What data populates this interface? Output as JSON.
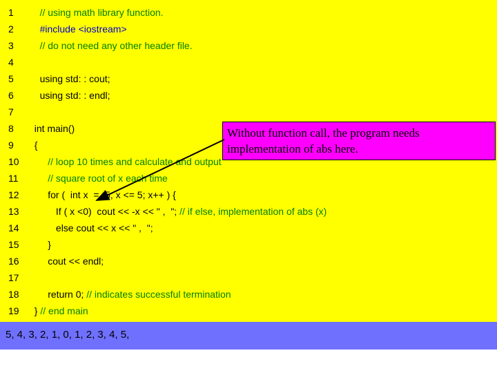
{
  "code": {
    "lines": [
      {
        "n": "1",
        "indent": "    ",
        "cls": "green",
        "text": "// using math library function."
      },
      {
        "n": "2",
        "indent": "    ",
        "cls": "blue",
        "text": "#include <iostream>"
      },
      {
        "n": "3",
        "indent": "    ",
        "cls": "green",
        "text": "// do not need any other header file."
      },
      {
        "n": "4",
        "indent": "",
        "cls": "",
        "text": " "
      },
      {
        "n": "5",
        "indent": "    ",
        "cls": "",
        "text": "using std: : cout;"
      },
      {
        "n": "6",
        "indent": "    ",
        "cls": "",
        "text": "using std: : endl;"
      },
      {
        "n": "7",
        "indent": "",
        "cls": "",
        "text": " "
      },
      {
        "n": "8",
        "indent": "  ",
        "cls": "",
        "text": "int main()"
      },
      {
        "n": "9",
        "indent": "  ",
        "cls": "",
        "text": "{"
      },
      {
        "n": "10",
        "indent": "       ",
        "cls": "green",
        "text": "// loop 10 times and calculate and output"
      },
      {
        "n": "11",
        "indent": "       ",
        "cls": "green",
        "text": "// square root of x each time"
      },
      {
        "n": "12",
        "indent": "       ",
        "cls": "",
        "text": "for (  int x  = -5; x <= 5; x++ ) {  "
      },
      {
        "n": "13",
        "indent": "          ",
        "cls": "mixed13",
        "text": ""
      },
      {
        "n": "14",
        "indent": "          ",
        "cls": "",
        "text": "else cout << x << \" ,  \";"
      },
      {
        "n": "15",
        "indent": "       ",
        "cls": "",
        "text": "}"
      },
      {
        "n": "16",
        "indent": "       ",
        "cls": "",
        "text": "cout << endl;"
      },
      {
        "n": "17",
        "indent": "",
        "cls": "",
        "text": " "
      },
      {
        "n": "18",
        "indent": "       ",
        "cls": "mixed18",
        "text": ""
      },
      {
        "n": "19",
        "indent": "  ",
        "cls": "mixed19",
        "text": ""
      }
    ],
    "line13_a": "If ( x <0)  cout << -x << \" ,  \"; ",
    "line13_b": "// if else, implementation of abs (x)",
    "line18_a": "return 0; ",
    "line18_b": "// indicates successful termination",
    "line19_a": "} ",
    "line19_b": "// end main"
  },
  "callout": {
    "line1": "Without function call, the program needs",
    "line2": "implementation of abs here."
  },
  "output": {
    "text": "5, 4, 3, 2, 1, 0, 1, 2, 3, 4, 5,"
  }
}
